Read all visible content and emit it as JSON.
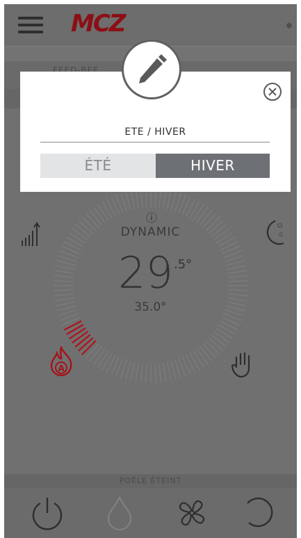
{
  "header": {
    "logo": "MCZ"
  },
  "background": {
    "strip_text": "FEED-BEE"
  },
  "dial": {
    "mode": "DYNAMIC",
    "temperature_whole": "29",
    "temperature_decimal": ".5°",
    "set_temperature": "35.0°",
    "accent_color": "#b0121a",
    "level_fraction": 0.12
  },
  "status": {
    "text": "POÊLE ÉTEINT"
  },
  "dialog": {
    "title": "ETE / HIVER",
    "options": [
      "ÉTÉ",
      "HIVER"
    ],
    "selected": "HIVER"
  },
  "icons": {
    "menu": "hamburger-icon",
    "snow": "snowflake-icon",
    "edit": "pencil-icon",
    "close": "close-circle-icon",
    "info": "info-icon",
    "signal": "signal-bars-icon",
    "moon": "moon-stars-icon",
    "flame": "flame-auto-icon",
    "hand": "hand-icon",
    "power": "power-icon",
    "drop": "drop-icon",
    "fan": "fan-icon",
    "refresh": "refresh-icon"
  }
}
